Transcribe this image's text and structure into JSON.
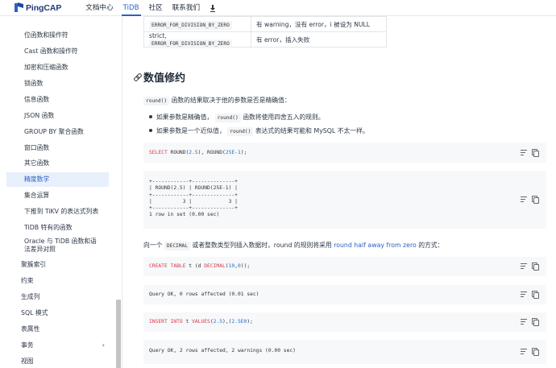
{
  "nav": {
    "logo": "PingCAP",
    "links": [
      "文档中心",
      "TiDB",
      "社区",
      "联系我们"
    ],
    "active": "TiDB"
  },
  "sidebar": {
    "items": [
      {
        "label": "位函数和操作符"
      },
      {
        "label": "Cast 函数和操作符"
      },
      {
        "label": "加密和压缩函数"
      },
      {
        "label": "锁函数"
      },
      {
        "label": "信息函数"
      },
      {
        "label": "JSON 函数"
      },
      {
        "label": "GROUP BY 聚合函数"
      },
      {
        "label": "窗口函数"
      },
      {
        "label": "其它函数"
      },
      {
        "label": "精度数学",
        "active": true
      },
      {
        "label": "集合运算"
      },
      {
        "label": "下推到 TiKV 的表达式列表"
      },
      {
        "label": "TiDB 特有的函数"
      },
      {
        "label": "Oracle 与 TiDB 函数和语法差异对照"
      },
      {
        "label": "聚簇索引"
      },
      {
        "label": "约束"
      },
      {
        "label": "生成列"
      },
      {
        "label": "SQL 模式"
      },
      {
        "label": "表属性"
      },
      {
        "label": "事务"
      },
      {
        "label": "视图"
      }
    ],
    "chevron": "›"
  },
  "table": {
    "rows": [
      {
        "c1_code": "ERROR_FOR_DIVISION_BY_ZERO",
        "c1_prefix": "",
        "c2": "有 warning，没有 error，i 被设为 NULL"
      },
      {
        "c1_code": "ERROR_FOR_DIVISION_BY_ZERO",
        "c1_prefix": "strict, ",
        "c2": "有 error，插入失败"
      }
    ]
  },
  "section": {
    "heading": "数值修约",
    "p1_code": "round()",
    "p1_text": "函数的结果取决于他的参数是否是精确值：",
    "b1_pre": "如果参数是精确值，",
    "b1_code": "round()",
    "b1_post": "函数将使用四舍五入的规则。",
    "b2_pre": "如果参数是一个近似值，",
    "b2_code": "round()",
    "b2_post": "表达式的结果可能和 MySQL 不太一样。",
    "p2_pre": "向一个",
    "p2_code": "DECIMAL",
    "p2_mid": "或者整数类型列插入数据时，round 的规则将采用",
    "p2_link": "round half away from zero",
    "p2_post": "的方式："
  },
  "code": {
    "c1_kw": "SELECT",
    "c1_a": " ROUND(",
    "c1_n1": "2.5",
    "c1_b": "), ROUND(",
    "c1_n2": "25E-1",
    "c1_c": ");",
    "out1": "+------------+--------------+\n| ROUND(2.5) | ROUND(25E-1) |\n+------------+--------------+\n|          3 |            3 |\n+------------+--------------+\n1 row in set (0.00 sec)",
    "c2_kw": "CREATE TABLE",
    "c2_a": " t (d ",
    "c2_kw2": "DECIMAL",
    "c2_b": "(",
    "c2_n1": "10",
    "c2_c": ",",
    "c2_n2": "0",
    "c2_d": "));",
    "out2": "Query OK, 0 rows affected (0.01 sec)",
    "c3_kw": "INSERT INTO",
    "c3_a": " t ",
    "c3_kw2": "VALUES",
    "c3_b": "(",
    "c3_n1": "2.5",
    "c3_c": "),(",
    "c3_n2": "2.5E0",
    "c3_d": ");",
    "out3": "Query OK, 2 rows affected, 2 warnings (0.00 sec)"
  },
  "colors": {
    "accent": "#2b5fc7",
    "keyword": "#d73a49",
    "number": "#1c6fc7",
    "code_bg": "#f7f8fa",
    "active_bg": "#e8f0fc"
  }
}
